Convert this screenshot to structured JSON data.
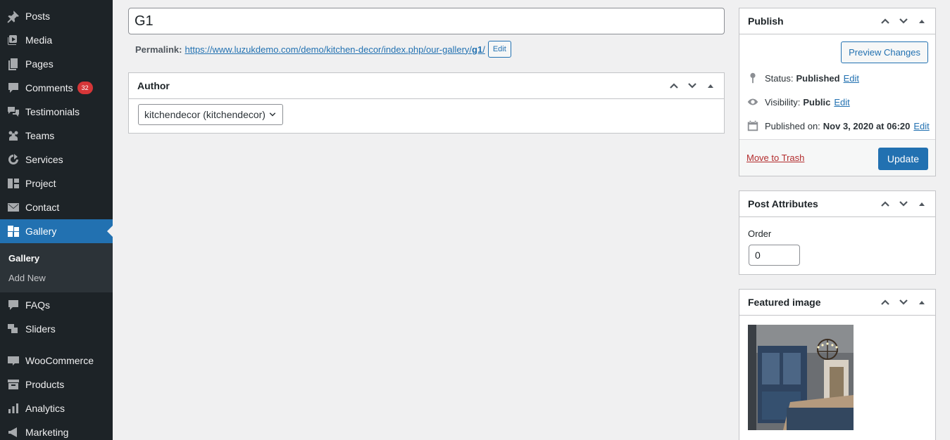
{
  "sidebar": {
    "items": [
      {
        "label": "Posts",
        "icon": "pushpin-icon"
      },
      {
        "label": "Media",
        "icon": "media-icon"
      },
      {
        "label": "Pages",
        "icon": "pages-icon"
      },
      {
        "label": "Comments",
        "icon": "comments-icon",
        "badge": "32"
      },
      {
        "label": "Testimonials",
        "icon": "testimonials-icon"
      },
      {
        "label": "Teams",
        "icon": "teams-icon"
      },
      {
        "label": "Services",
        "icon": "services-icon"
      },
      {
        "label": "Project",
        "icon": "project-icon"
      },
      {
        "label": "Contact",
        "icon": "email-icon"
      },
      {
        "label": "Gallery",
        "icon": "gallery-icon"
      },
      {
        "label": "FAQs",
        "icon": "faq-icon"
      },
      {
        "label": "Sliders",
        "icon": "sliders-icon"
      },
      {
        "label": "WooCommerce",
        "icon": "woocommerce-icon"
      },
      {
        "label": "Products",
        "icon": "archive-icon"
      },
      {
        "label": "Analytics",
        "icon": "chart-bar-icon"
      },
      {
        "label": "Marketing",
        "icon": "megaphone-icon"
      }
    ],
    "submenu": {
      "current": "Gallery",
      "add_new": "Add New"
    }
  },
  "editor": {
    "title": "G1",
    "permalink_label": "Permalink:",
    "permalink_url": "https://www.luzukdemo.com/demo/kitchen-decor/index.php/our-gallery/",
    "permalink_slug": "g1",
    "permalink_edit": "Edit"
  },
  "author_box": {
    "title": "Author",
    "selected": "kitchendecor (kitchendecor)"
  },
  "publish_box": {
    "title": "Publish",
    "preview_label": "Preview Changes",
    "status_label": "Status:",
    "status_value": "Published",
    "visibility_label": "Visibility:",
    "visibility_value": "Public",
    "published_label": "Published on:",
    "published_value": "Nov 3, 2020 at 06:20",
    "edit_label": "Edit",
    "trash_label": "Move to Trash",
    "update_label": "Update"
  },
  "attributes_box": {
    "title": "Post Attributes",
    "order_label": "Order",
    "order_value": "0"
  },
  "featured_box": {
    "title": "Featured image"
  },
  "colors": {
    "sidebar_bg": "#1d2327",
    "accent": "#2271b1",
    "badge": "#d63638",
    "trash": "#b32d2e"
  }
}
